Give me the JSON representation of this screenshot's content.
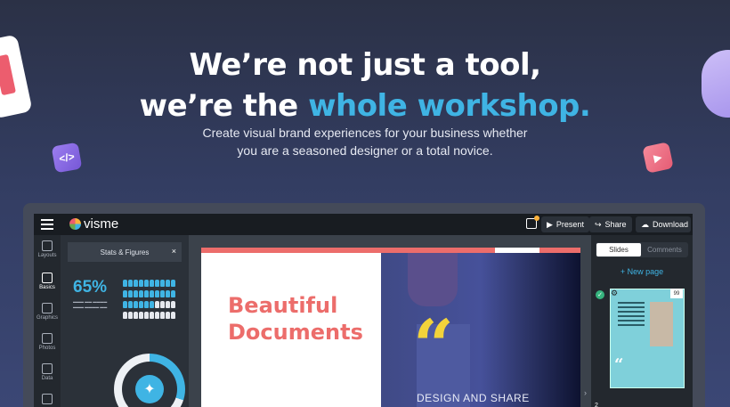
{
  "hero": {
    "line1": "We’re not just a tool,",
    "line2_prefix": "we’re the ",
    "line2_accent": "whole workshop.",
    "sub1": "Create visual brand experiences for your business whether",
    "sub2": "you are a seasoned designer or a total novice."
  },
  "deco": {
    "code_glyph": "</>",
    "play_glyph": "▶"
  },
  "app": {
    "logo": "visme",
    "toolbar": {
      "present": "Present",
      "share": "Share",
      "download": "Download"
    },
    "nav": [
      {
        "label": "Layouts"
      },
      {
        "label": "Basics"
      },
      {
        "label": "Graphics"
      },
      {
        "label": "Photos"
      },
      {
        "label": "Data"
      }
    ],
    "panel": {
      "title": "Stats & Figures",
      "close": "×",
      "percent": "65%"
    },
    "slide": {
      "title_line1": "Beautiful",
      "title_line2": "Documents",
      "quote": "“",
      "caption": "DESIGN AND SHARE"
    },
    "right": {
      "tab_slides": "Slides",
      "tab_comments": "Comments",
      "new_page": "+ New page",
      "badge": "99",
      "page_number": "2"
    }
  },
  "colors": {
    "accent": "#3fb4e4",
    "coral": "#ec6d6b",
    "yellow": "#f3d33a"
  }
}
